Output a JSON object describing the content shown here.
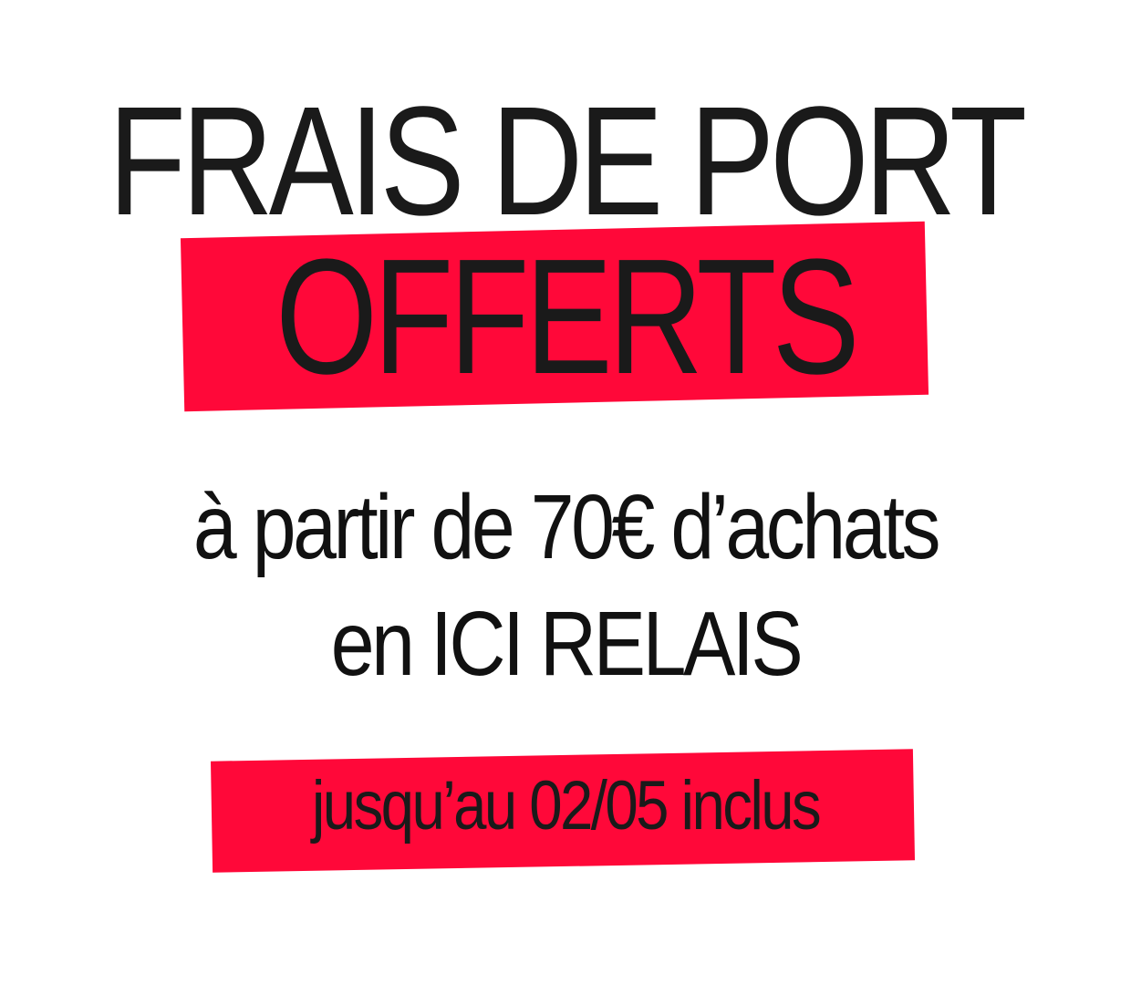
{
  "colors": {
    "accent": "#ff0839",
    "text": "#111111",
    "background": "#ffffff"
  },
  "banner": {
    "headline": "FRAIS DE PORT",
    "highlight": "OFFERTS",
    "condition_line_1": "à partir de 70€ d’achats",
    "condition_line_2": "en ICI RELAIS",
    "validity": "jusqu’au 02/05 inclus"
  }
}
